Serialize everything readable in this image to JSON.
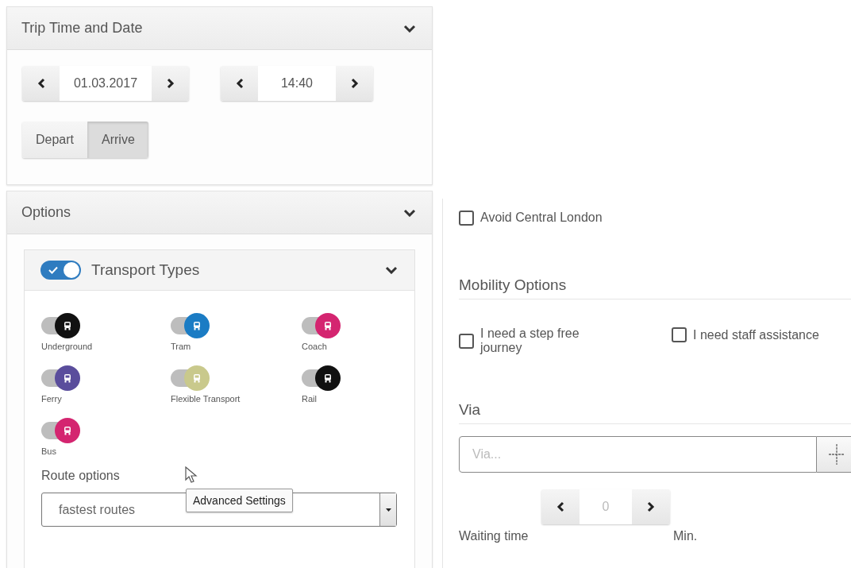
{
  "trip_panel": {
    "title": "Trip Time and Date",
    "expanded": true,
    "date": "01.03.2017",
    "time": "14:40",
    "modes": [
      {
        "label": "Depart",
        "selected": false
      },
      {
        "label": "Arrive",
        "selected": true
      }
    ]
  },
  "options_panel": {
    "title": "Options",
    "expanded": true,
    "transport_types": {
      "title": "Transport Types",
      "on": true,
      "expanded": true,
      "items": [
        {
          "label": "Underground",
          "on": true,
          "color": "#111111"
        },
        {
          "label": "Tram",
          "on": true,
          "color": "#1b7cc4"
        },
        {
          "label": "Coach",
          "on": true,
          "color": "#d42570"
        },
        {
          "label": "Ferry",
          "on": true,
          "color": "#5a4d9c"
        },
        {
          "label": "Flexible Transport",
          "on": true,
          "color": "#c9c98c"
        },
        {
          "label": "Rail",
          "on": true,
          "color": "#111111"
        },
        {
          "label": "Bus",
          "on": true,
          "color": "#d42570"
        }
      ]
    },
    "route_options": {
      "label": "Route options",
      "value": "fastest routes"
    },
    "tooltip": "Advanced Settings"
  },
  "avoid_central_london": {
    "label": "Avoid Central London",
    "checked": false
  },
  "mobility_options": {
    "title": "Mobility Options",
    "items": [
      {
        "label": "I need a step free journey",
        "checked": false
      },
      {
        "label": "I need staff assistance",
        "checked": false
      }
    ]
  },
  "via": {
    "title": "Via",
    "placeholder": "Via...",
    "waiting_time": {
      "label": "Waiting time",
      "value": "0",
      "unit": "Min."
    }
  }
}
